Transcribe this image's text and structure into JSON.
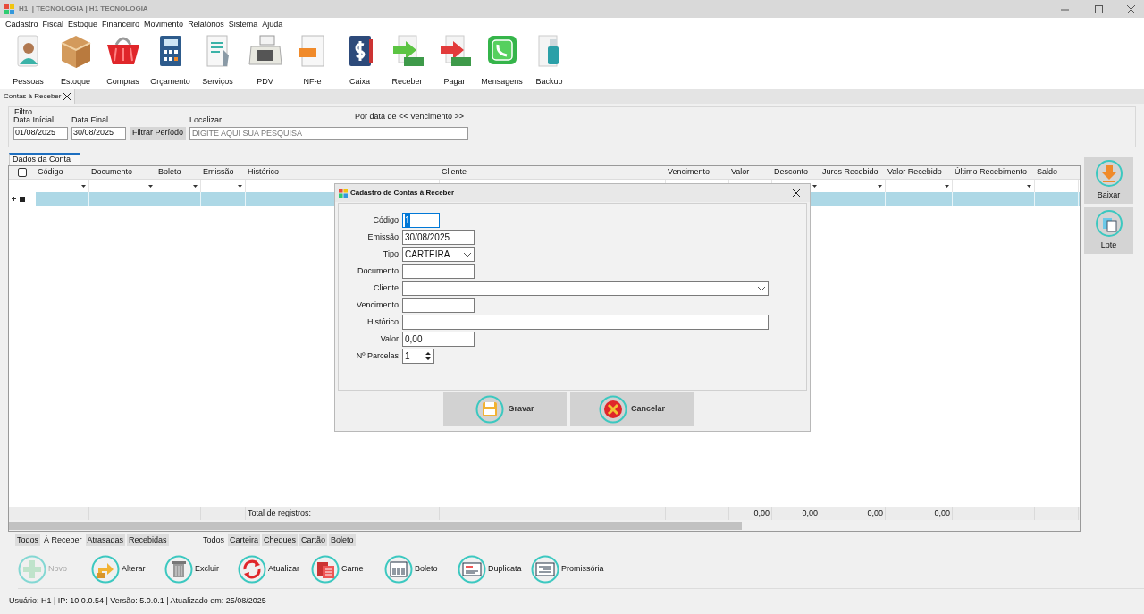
{
  "window": {
    "title": "H1  | TECNOLOGIA | H1 TECNOLOGIA"
  },
  "menu": [
    "Cadastro",
    "Fiscal",
    "Estoque",
    "Financeiro",
    "Movimento",
    "Relatórios",
    "Sistema",
    "Ajuda"
  ],
  "toolbar": [
    {
      "label": "Pessoas"
    },
    {
      "label": "Estoque"
    },
    {
      "label": "Compras"
    },
    {
      "label": "Orçamento"
    },
    {
      "label": "Serviços"
    },
    {
      "label": "PDV"
    },
    {
      "label": "NF-e"
    },
    {
      "label": "Caixa"
    },
    {
      "label": "Receber"
    },
    {
      "label": "Pagar"
    },
    {
      "label": "Mensagens"
    },
    {
      "label": "Backup"
    }
  ],
  "document_tabs": [
    {
      "label": "Contas à Receber",
      "selected": true
    }
  ],
  "filter": {
    "group_label": "Filtro",
    "start": {
      "label": "Data Inícial",
      "value": "01/08/2025"
    },
    "end": {
      "label": "Data Final",
      "value": "30/08/2025"
    },
    "button": "Filtrar Período",
    "search": {
      "label": "Localizar",
      "placeholder": "DIGITE AQUI SUA PESQUISA"
    },
    "date_mode": "Por data de << Vencimento >>"
  },
  "grid": {
    "tab": "Dados da Conta",
    "columns": [
      {
        "label": "Código",
        "filter": true
      },
      {
        "label": "Documento",
        "filter": true
      },
      {
        "label": "Boleto",
        "filter": true
      },
      {
        "label": "Emissão",
        "filter": true
      },
      {
        "label": "Histórico",
        "total": "Total de registros:"
      },
      {
        "label": "Cliente"
      },
      {
        "label": "Vencimento"
      },
      {
        "label": "Valor",
        "total": "0,00"
      },
      {
        "label": "Desconto",
        "filter": true,
        "total": "0,00"
      },
      {
        "label": "Juros Recebido",
        "filter": true,
        "total": "0,00"
      },
      {
        "label": "Valor Recebido",
        "filter": true,
        "total": "0,00"
      },
      {
        "label": "Último Recebimento",
        "filter": true
      },
      {
        "label": "Saldo",
        "filter": false
      }
    ],
    "header_checkbox": {
      "checked": false
    },
    "rows": [
      {
        "selected": true
      }
    ]
  },
  "side_buttons": [
    "Baixar",
    "Lote"
  ],
  "status_filters": [
    {
      "label": "Todos",
      "selected": false
    },
    {
      "label": "À Receber",
      "selected": true
    },
    {
      "label": "Atrasadas",
      "selected": false
    },
    {
      "label": "Recebidas",
      "selected": false
    }
  ],
  "type_filters": [
    {
      "label": "Todos",
      "selected": true
    },
    {
      "label": "Carteira",
      "selected": false
    },
    {
      "label": "Cheques",
      "selected": false
    },
    {
      "label": "Cartão",
      "selected": false
    },
    {
      "label": "Boleto",
      "selected": false
    }
  ],
  "actions": [
    {
      "label": "Novo",
      "disabled": true
    },
    {
      "label": "Alterar",
      "disabled": false
    },
    {
      "label": "Excluir",
      "disabled": false
    },
    {
      "label": "Atualizar",
      "disabled": false
    },
    {
      "label": "Carne",
      "disabled": false
    },
    {
      "label": "Boleto",
      "disabled": false
    },
    {
      "label": "Duplicata",
      "disabled": false
    },
    {
      "label": "Promissória",
      "disabled": false
    }
  ],
  "status_bar": "Usuário: H1 | IP: 10.0.0.54 | Versão: 5.0.0.1 | Atualizado em: 25/08/2025",
  "dialog": {
    "title": "Cadastro de Contas à Receber",
    "fields": [
      {
        "label": "Código",
        "kind": "short",
        "value": "1",
        "focused": true
      },
      {
        "label": "Emissão",
        "kind": "text",
        "value": "30/08/2025",
        "focused": false
      },
      {
        "label": "Tipo",
        "kind": "select",
        "value": "CARTEIRA",
        "focused": false
      },
      {
        "label": "Documento",
        "kind": "text",
        "focused": false
      },
      {
        "label": "Cliente",
        "kind": "wide_select",
        "focused": false
      },
      {
        "label": "Vencimento",
        "kind": "text",
        "focused": false
      },
      {
        "label": "Histórico",
        "kind": "wide",
        "focused": false
      },
      {
        "label": "Valor",
        "kind": "number",
        "value": "0,00",
        "focused": false
      },
      {
        "label": "Nº Parcelas",
        "kind": "spin",
        "value": "1",
        "focused": false
      }
    ],
    "buttons": [
      {
        "label": "Gravar",
        "kind": "save"
      },
      {
        "label": "Cancelar",
        "kind": "cancel"
      }
    ]
  }
}
